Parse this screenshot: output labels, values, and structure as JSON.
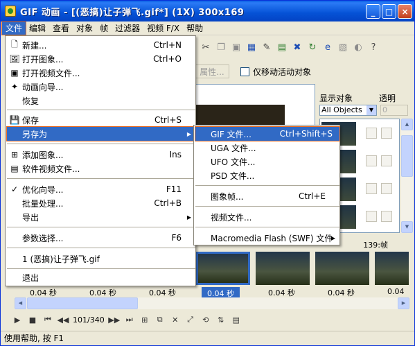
{
  "window": {
    "title": "GIF 动画 - [(恶搞)让子弹飞.gif*] (1X) 300x169",
    "minimize": "_",
    "maximize": "□",
    "close": "×"
  },
  "menubar": [
    "文件",
    "编辑",
    "查看",
    "对象",
    "帧",
    "过滤器",
    "视频 F/X",
    "帮助"
  ],
  "options": {
    "props_button": "属性...",
    "checkbox_label": "仅移动活动对象"
  },
  "right_panel": {
    "header_objects": "显示对象",
    "header_opacity": "透明",
    "select_value": "All Objects",
    "opacity_value": "0"
  },
  "frames": {
    "labels": [
      "0.04 秒",
      "0.04 秒",
      "0.04 秒",
      "0.04 秒",
      "0.04 秒",
      "0.04 秒",
      "0.04 秒"
    ],
    "last_frame_label": "139:帧"
  },
  "player": {
    "counter": "101/340"
  },
  "status": "使用帮助, 按 F1",
  "file_menu": {
    "items": [
      {
        "label": "新建...",
        "shortcut": "Ctrl+N",
        "icon": "new-file-icon"
      },
      {
        "label": "打开图象...",
        "shortcut": "Ctrl+O",
        "icon": "open-image-icon"
      },
      {
        "label": "打开视频文件...",
        "shortcut": "",
        "icon": "open-video-icon"
      },
      {
        "label": "动画向导...",
        "shortcut": "",
        "icon": "wizard-icon"
      },
      {
        "label": "恢复",
        "shortcut": "",
        "icon": ""
      },
      {
        "label": "保存",
        "shortcut": "Ctrl+S",
        "icon": "save-icon"
      },
      {
        "label": "另存为",
        "shortcut": "",
        "icon": ""
      },
      {
        "label": "添加图象...",
        "shortcut": "Ins",
        "icon": "add-image-icon"
      },
      {
        "label": "软件视频文件...",
        "shortcut": "",
        "icon": "add-video-icon"
      },
      {
        "label": "优化向导...",
        "shortcut": "F11",
        "icon": "optimize-icon"
      },
      {
        "label": "批量处理...",
        "shortcut": "Ctrl+B",
        "icon": ""
      },
      {
        "label": "导出",
        "shortcut": "",
        "icon": ""
      },
      {
        "label": "参数选择...",
        "shortcut": "F6",
        "icon": ""
      },
      {
        "label": "1 (恶搞)让子弹飞.gif",
        "shortcut": "",
        "icon": ""
      },
      {
        "label": "退出",
        "shortcut": "",
        "icon": ""
      }
    ]
  },
  "saveas_submenu": {
    "items": [
      {
        "label": "GIF 文件...",
        "shortcut": "Ctrl+Shift+S"
      },
      {
        "label": "UGA 文件..."
      },
      {
        "label": "UFO 文件..."
      },
      {
        "label": "PSD 文件..."
      },
      {
        "label": "图象帧...",
        "shortcut": "Ctrl+E"
      },
      {
        "label": "视频文件..."
      },
      {
        "label": "Macromedia Flash (SWF) 文件"
      }
    ]
  }
}
